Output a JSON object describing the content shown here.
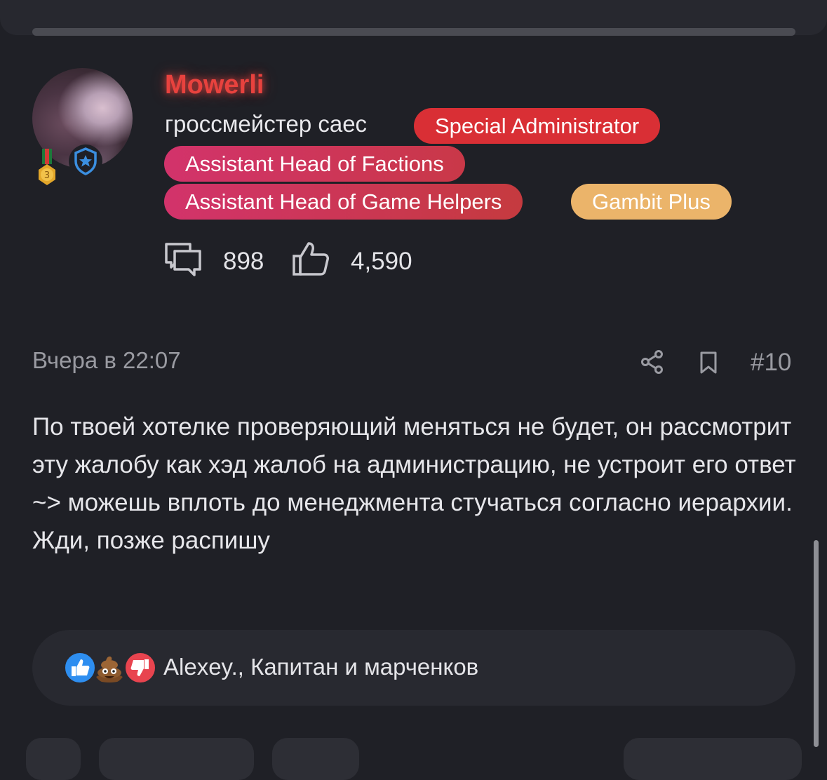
{
  "user": {
    "name": "Mowerli",
    "title": "гроссмейстер саес",
    "medal_level": "3",
    "badges": {
      "special": "Special Administrator",
      "factions": "Assistant Head of Factions",
      "helpers": "Assistant Head of Game Helpers",
      "gambit": "Gambit Plus"
    },
    "stats": {
      "messages": "898",
      "reactions": "4,590"
    }
  },
  "post": {
    "timestamp": "Вчера в 22:07",
    "number": "#10",
    "body": "По твоей хотелке проверяющий меняться не будет, он рассмотрит эту жалобу как хэд жалоб на администрацию, не устроит его ответ ~> можешь вплоть до менеджмента стучаться согласно иерархии. Жди, позже распишу"
  },
  "reactions": {
    "icons": [
      "like-icon",
      "poop-icon",
      "dislike-icon"
    ],
    "text": "Alexey., Капитан и марченков"
  },
  "colors": {
    "background": "#1f2026",
    "username": "#e8423e",
    "special_admin": "#d92f35",
    "assistant_head": "#d2336b",
    "gambit_plus": "#ebb46a"
  }
}
